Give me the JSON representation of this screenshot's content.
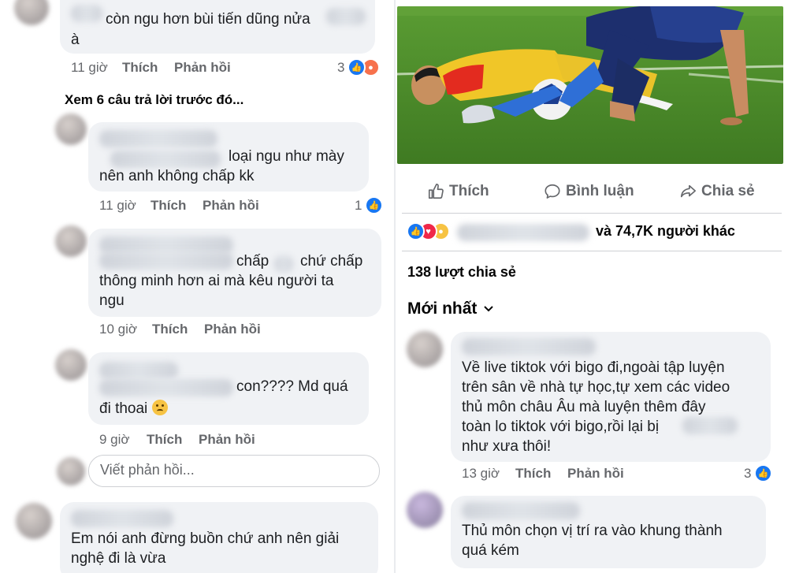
{
  "left": {
    "comment1": {
      "text_line1": "còn ngu hơn bùi tiến dũng nửa",
      "text_line2": "à",
      "time": "11 giờ",
      "like_label": "Thích",
      "reply_label": "Phản hồi",
      "reaction_count": "3"
    },
    "view_previous": "Xem 6 câu trả lời trước đó...",
    "reply1": {
      "text_line1": "loại ngu như mày",
      "text_line2": "nên anh không chấp kk",
      "time": "11 giờ",
      "like_label": "Thích",
      "reply_label": "Phản hồi",
      "reaction_count": "1"
    },
    "reply2": {
      "text_line1a": "chấp",
      "text_line1b": "chứ chấp",
      "text_line2": "thông minh hơn ai mà kêu người ta",
      "text_line3": "ngu",
      "time": "10 giờ",
      "like_label": "Thích",
      "reply_label": "Phản hồi"
    },
    "reply3": {
      "text_line1": "con???? Md quá",
      "text_line2": "đi thoai",
      "time": "9 giờ",
      "like_label": "Thích",
      "reply_label": "Phản hồi"
    },
    "reply_input_placeholder": "Viết phản hồi...",
    "comment2": {
      "text_line1": "Em nói anh đừng buồn chứ anh nên giải",
      "text_line2": "nghệ đi là vừa"
    }
  },
  "right": {
    "post_actions": {
      "like": "Thích",
      "comment": "Bình luận",
      "share": "Chia sẻ"
    },
    "reactions_summary": "và 74,7K người khác",
    "shares": "138 lượt chia sẻ",
    "sort_label": "Mới nhất",
    "comment1": {
      "line1": "Về live tiktok với bigo đi,ngoài tập luyện",
      "line2": "trên sân về nhà tự học,tự xem các video",
      "line3": "thủ môn châu Âu mà luyện thêm đây",
      "line4": "toàn lo tiktok với bigo,rồi lại bị",
      "line5": "như xưa thôi!",
      "time": "13 giờ",
      "like_label": "Thích",
      "reply_label": "Phản hồi",
      "reaction_count": "3"
    },
    "comment2": {
      "line1": "Thủ môn chọn vị trí ra vào khung thành",
      "line2": "quá kém"
    }
  },
  "colors": {
    "bubble": "#f0f2f5",
    "meta_text": "#65676b",
    "like_blue": "#1877f2",
    "grass": "#4e8a2a"
  },
  "icons": [
    "like-icon",
    "comment-icon",
    "share-icon",
    "chevron-down-icon",
    "like-reaction-icon",
    "angry-reaction-icon",
    "heart-reaction-icon",
    "sad-reaction-icon",
    "confused-emoji-icon"
  ]
}
